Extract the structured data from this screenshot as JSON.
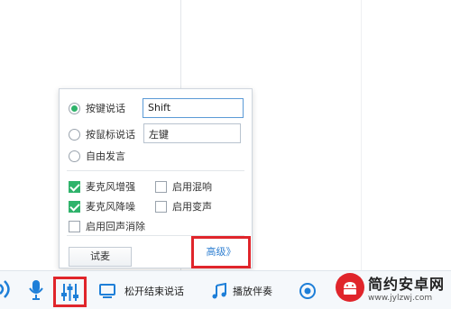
{
  "panel": {
    "key_talk_label": "按键说话",
    "key_talk_value": "Shift",
    "mouse_talk_label": "按鼠标说话",
    "mouse_talk_value": "左键",
    "free_talk_label": "自由发言",
    "mic_boost_label": "麦克风增强",
    "reverb_label": "启用混响",
    "mic_noise_label": "麦克风降噪",
    "voice_change_label": "启用变声",
    "echo_cancel_label": "启用回声消除",
    "test_button_label": "试麦",
    "advanced_link_label": "高级》"
  },
  "state": {
    "talk_mode": "按键说话",
    "mic_boost": true,
    "reverb": false,
    "mic_noise": true,
    "voice_change": false,
    "echo_cancel": false
  },
  "toolbar": {
    "release_end_label": "松开结束说话",
    "play_accompaniment_label": "播放伴奏"
  },
  "watermark": {
    "title": "简约安卓网",
    "url": "www.jylzwj.com"
  },
  "colors": {
    "accent_green": "#2fb36b",
    "highlight_red": "#e0252b",
    "link_blue": "#2f7fd1"
  }
}
